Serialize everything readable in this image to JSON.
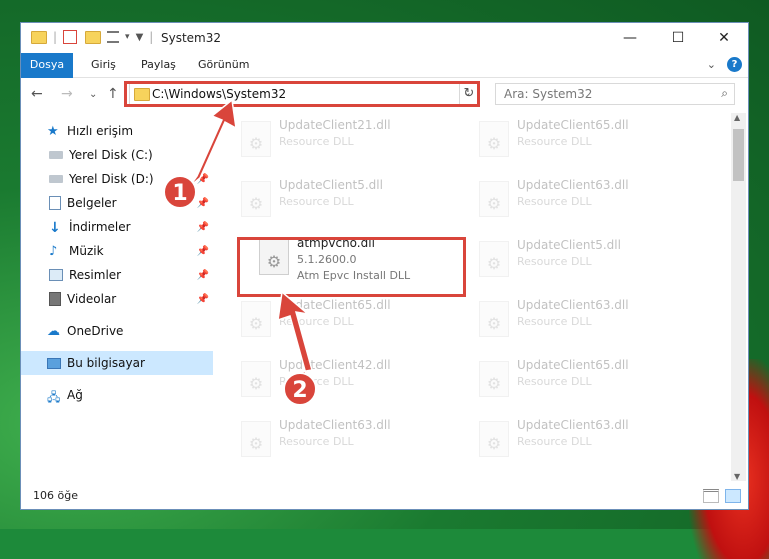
{
  "window": {
    "title": "System32",
    "minimize_label": "—",
    "maximize_label": "☐",
    "close_label": "✕"
  },
  "ribbon": {
    "tabs": [
      "Dosya",
      "Giriş",
      "Paylaş",
      "Görünüm"
    ],
    "help_label": "?"
  },
  "nav": {
    "address": "C:\\Windows\\System32",
    "search_placeholder": "Ara: System32"
  },
  "sidebar": {
    "items": [
      {
        "label": "Hızlı erişim",
        "icon": "star-icon"
      },
      {
        "label": "Yerel Disk (C:)",
        "icon": "drive-icon"
      },
      {
        "label": "Yerel Disk (D:)",
        "icon": "drive-icon"
      },
      {
        "label": "Belgeler",
        "icon": "documents-icon"
      },
      {
        "label": "İndirmeler",
        "icon": "download-icon"
      },
      {
        "label": "Müzik",
        "icon": "music-icon"
      },
      {
        "label": "Resimler",
        "icon": "pictures-icon"
      },
      {
        "label": "Videolar",
        "icon": "videos-icon"
      },
      {
        "label": "OneDrive",
        "icon": "cloud-icon"
      },
      {
        "label": "Bu bilgisayar",
        "icon": "computer-icon"
      },
      {
        "label": "Ağ",
        "icon": "network-icon"
      }
    ]
  },
  "files": {
    "left": [
      {
        "name": "UpdateClient21.dll",
        "line2": "Resource DLL"
      },
      {
        "name": "UpdateClient5.dll",
        "line2": "Resource DLL"
      },
      {
        "name": "atmpvcno.dll",
        "line2": "5.1.2600.0",
        "line3": "Atm Epvc Install DLL"
      },
      {
        "name": "UpdateClient65.dll",
        "line2": "Resource DLL"
      },
      {
        "name": "UpdateClient42.dll",
        "line2": "Resource DLL"
      },
      {
        "name": "UpdateClient63.dll",
        "line2": "Resource DLL"
      }
    ],
    "right": [
      {
        "name": "UpdateClient65.dll",
        "line2": "Resource DLL"
      },
      {
        "name": "UpdateClient63.dll",
        "line2": "Resource DLL"
      },
      {
        "name": "UpdateClient5.dll",
        "line2": "Resource DLL"
      },
      {
        "name": "UpdateClient63.dll",
        "line2": "Resource DLL"
      },
      {
        "name": "UpdateClient65.dll",
        "line2": "Resource DLL"
      },
      {
        "name": "UpdateClient63.dll",
        "line2": "Resource DLL"
      }
    ]
  },
  "status": {
    "count": "106 öğe"
  },
  "callouts": {
    "step1": "1",
    "step2": "2"
  },
  "colors": {
    "accent": "#1979ca",
    "highlight": "#d9453b"
  }
}
